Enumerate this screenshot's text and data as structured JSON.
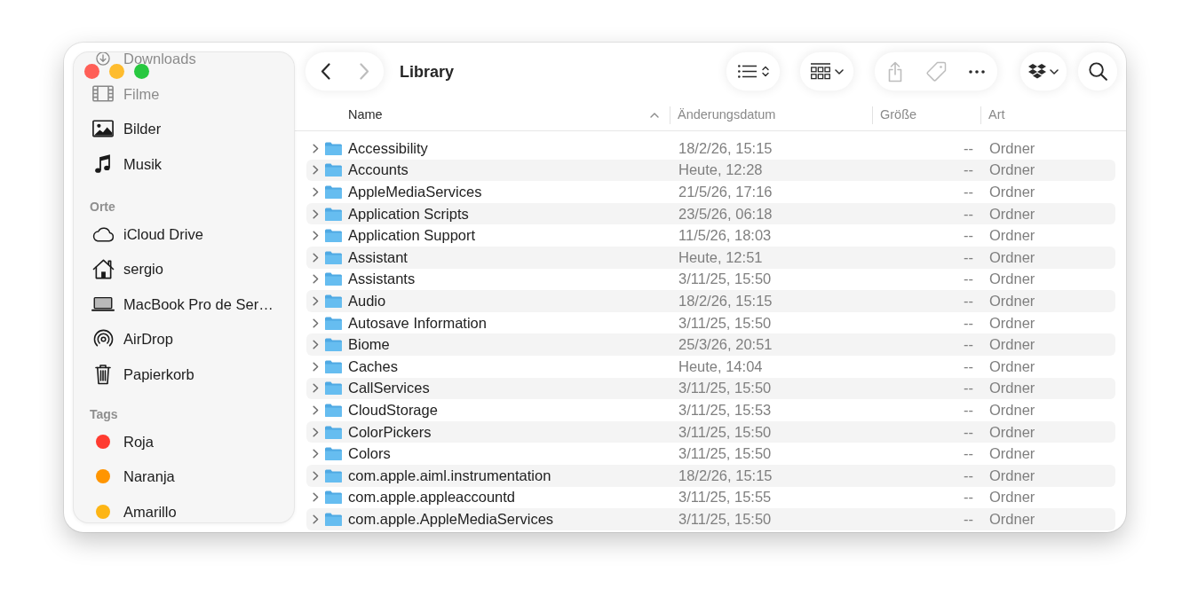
{
  "sidebar": {
    "groups": [
      {
        "items": [
          {
            "label": "Downloads"
          },
          {
            "label": "Filme"
          },
          {
            "label": "Bilder"
          },
          {
            "label": "Musik"
          }
        ]
      },
      {
        "heading": "Orte",
        "items": [
          {
            "label": "iCloud Drive"
          },
          {
            "label": "sergio"
          },
          {
            "label": "MacBook Pro de Ser…"
          },
          {
            "label": "AirDrop"
          },
          {
            "label": "Papierkorb"
          }
        ]
      },
      {
        "heading": "Tags",
        "items": [
          {
            "label": "Roja",
            "color": "#ff3b30"
          },
          {
            "label": "Naranja",
            "color": "#ff9500"
          },
          {
            "label": "Amarillo",
            "color": "#fdb515"
          }
        ]
      }
    ]
  },
  "toolbar": {
    "navigation": [
      {
        "kind": "back",
        "disabled": false
      },
      {
        "kind": "forward",
        "disabled": true
      }
    ],
    "title": "Library",
    "groups": [
      {
        "buttons": [
          {
            "kind": "view",
            "disabled": false
          }
        ]
      },
      {
        "buttons": [
          {
            "kind": "group",
            "disabled": false
          }
        ]
      },
      {
        "buttons": [
          {
            "kind": "share",
            "disabled": true
          },
          {
            "kind": "tag",
            "disabled": true
          },
          {
            "kind": "more",
            "disabled": false
          }
        ]
      },
      {
        "buttons": [
          {
            "kind": "extension",
            "disabled": false
          }
        ]
      },
      {
        "buttons": [
          {
            "kind": "search",
            "disabled": false
          }
        ]
      }
    ]
  },
  "table": {
    "columns": [
      {
        "label": "Name",
        "sorted": true
      },
      {
        "label": "Änderungsdatum",
        "sorted": false
      },
      {
        "label": "Größe",
        "sorted": false
      },
      {
        "label": "Art",
        "sorted": false
      }
    ],
    "rows": [
      {
        "name": "Accessibility",
        "modified": "18/2/26, 15:15",
        "size": "--",
        "file_type": "Ordner",
        "expanded": false
      },
      {
        "name": "Accounts",
        "modified": "Heute, 12:28",
        "size": "--",
        "file_type": "Ordner",
        "expanded": false
      },
      {
        "name": "AppleMediaServices",
        "modified": "21/5/26, 17:16",
        "size": "--",
        "file_type": "Ordner",
        "expanded": false
      },
      {
        "name": "Application Scripts",
        "modified": "23/5/26, 06:18",
        "size": "--",
        "file_type": "Ordner",
        "expanded": false
      },
      {
        "name": "Application Support",
        "modified": "11/5/26, 18:03",
        "size": "--",
        "file_type": "Ordner",
        "expanded": false
      },
      {
        "name": "Assistant",
        "modified": "Heute, 12:51",
        "size": "--",
        "file_type": "Ordner",
        "expanded": false
      },
      {
        "name": "Assistants",
        "modified": "3/11/25, 15:50",
        "size": "--",
        "file_type": "Ordner",
        "expanded": false
      },
      {
        "name": "Audio",
        "modified": "18/2/26, 15:15",
        "size": "--",
        "file_type": "Ordner",
        "expanded": false
      },
      {
        "name": "Autosave Information",
        "modified": "3/11/25, 15:50",
        "size": "--",
        "file_type": "Ordner",
        "expanded": false
      },
      {
        "name": "Biome",
        "modified": "25/3/26, 20:51",
        "size": "--",
        "file_type": "Ordner",
        "expanded": false
      },
      {
        "name": "Caches",
        "modified": "Heute, 14:04",
        "size": "--",
        "file_type": "Ordner",
        "expanded": false
      },
      {
        "name": "CallServices",
        "modified": "3/11/25, 15:50",
        "size": "--",
        "file_type": "Ordner",
        "expanded": false
      },
      {
        "name": "CloudStorage",
        "modified": "3/11/25, 15:53",
        "size": "--",
        "file_type": "Ordner",
        "expanded": false
      },
      {
        "name": "ColorPickers",
        "modified": "3/11/25, 15:50",
        "size": "--",
        "file_type": "Ordner",
        "expanded": false
      },
      {
        "name": "Colors",
        "modified": "3/11/25, 15:50",
        "size": "--",
        "file_type": "Ordner",
        "expanded": false
      },
      {
        "name": "com.apple.aiml.instrumentation",
        "modified": "18/2/26, 15:15",
        "size": "--",
        "file_type": "Ordner",
        "expanded": false
      },
      {
        "name": "com.apple.appleaccountd",
        "modified": "3/11/25, 15:55",
        "size": "--",
        "file_type": "Ordner",
        "expanded": false
      },
      {
        "name": "com.apple.AppleMediaServices",
        "modified": "3/11/25, 15:50",
        "size": "--",
        "file_type": "Ordner",
        "expanded": false
      }
    ]
  }
}
